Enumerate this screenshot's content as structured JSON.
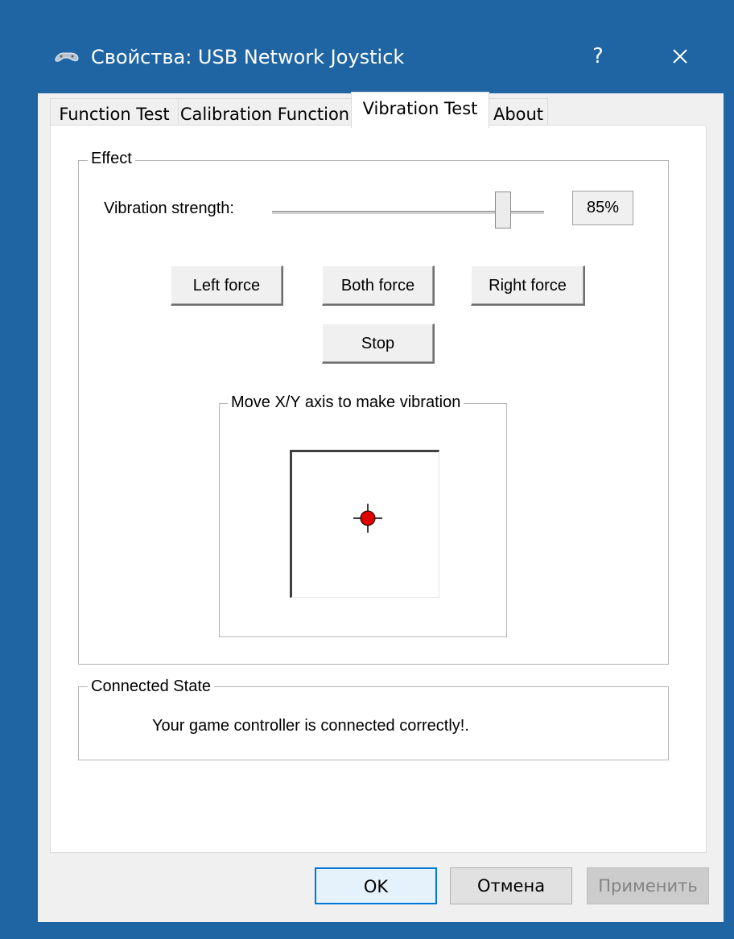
{
  "window": {
    "title": "Свойства: USB Network Joystick",
    "help_label": "?"
  },
  "tabs": [
    {
      "label": "Function Test",
      "active": false
    },
    {
      "label": "Calibration Function",
      "active": false
    },
    {
      "label": "Vibration Test",
      "active": true
    },
    {
      "label": "About",
      "active": false
    }
  ],
  "effect": {
    "group_label": "Effect",
    "strength_label": "Vibration strength:",
    "strength_value": "85%",
    "slider_fraction": 0.85,
    "buttons": {
      "left": "Left force",
      "both": "Both force",
      "right": "Right force",
      "stop": "Stop"
    },
    "xy_group_label": "Move X/Y axis to make vibration",
    "indicator_color": "#e00000"
  },
  "connected": {
    "group_label": "Connected State",
    "message": "Your game controller is connected correctly!."
  },
  "footer": {
    "ok": "OK",
    "cancel": "Отмена",
    "apply": "Применить"
  },
  "colors": {
    "titlebar": "#1f64a3",
    "ok_border": "#0078d7"
  }
}
